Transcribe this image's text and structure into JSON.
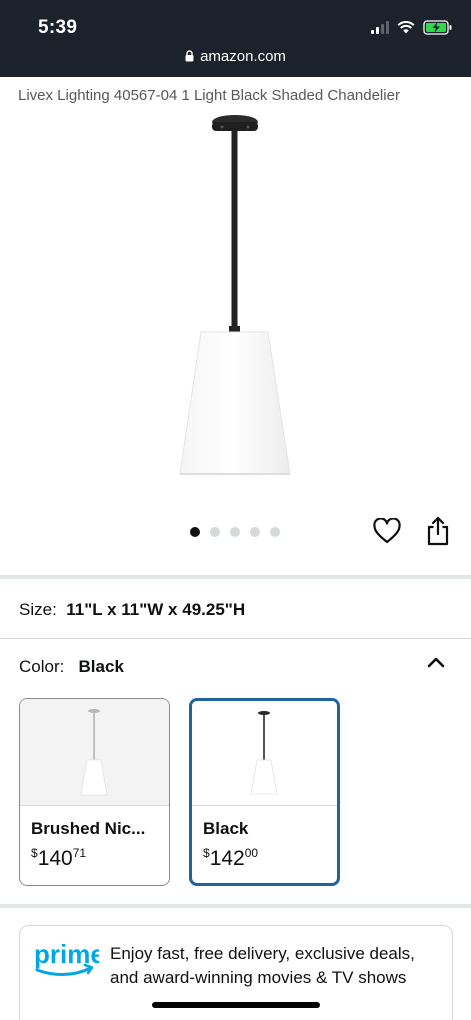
{
  "status_bar": {
    "time": "5:39"
  },
  "browser": {
    "url": "amazon.com"
  },
  "product": {
    "title": "Livex Lighting 40567-04 1 Light Black Shaded Chandelier",
    "image_name": "pendant-lamp-white-shade",
    "carousel": {
      "total": 5,
      "active": 1
    }
  },
  "size": {
    "label": "Size:",
    "value": "11\"L x 11\"W x 49.25\"H"
  },
  "color": {
    "label": "Color:",
    "value": "Black",
    "options": [
      {
        "name": "Brushed Nic...",
        "currency": "$",
        "dollars": "140",
        "cents": "71",
        "selected": false
      },
      {
        "name": "Black",
        "currency": "$",
        "dollars": "142",
        "cents": "00",
        "selected": true
      }
    ]
  },
  "prime": {
    "logo_text": "prime",
    "text": "Enjoy fast, free delivery, exclusive deals, and award-winning movies & TV shows"
  },
  "colors": {
    "header_bg": "#1b222c",
    "selected_border": "#2162a1",
    "prime_blue": "#00a8e1"
  }
}
